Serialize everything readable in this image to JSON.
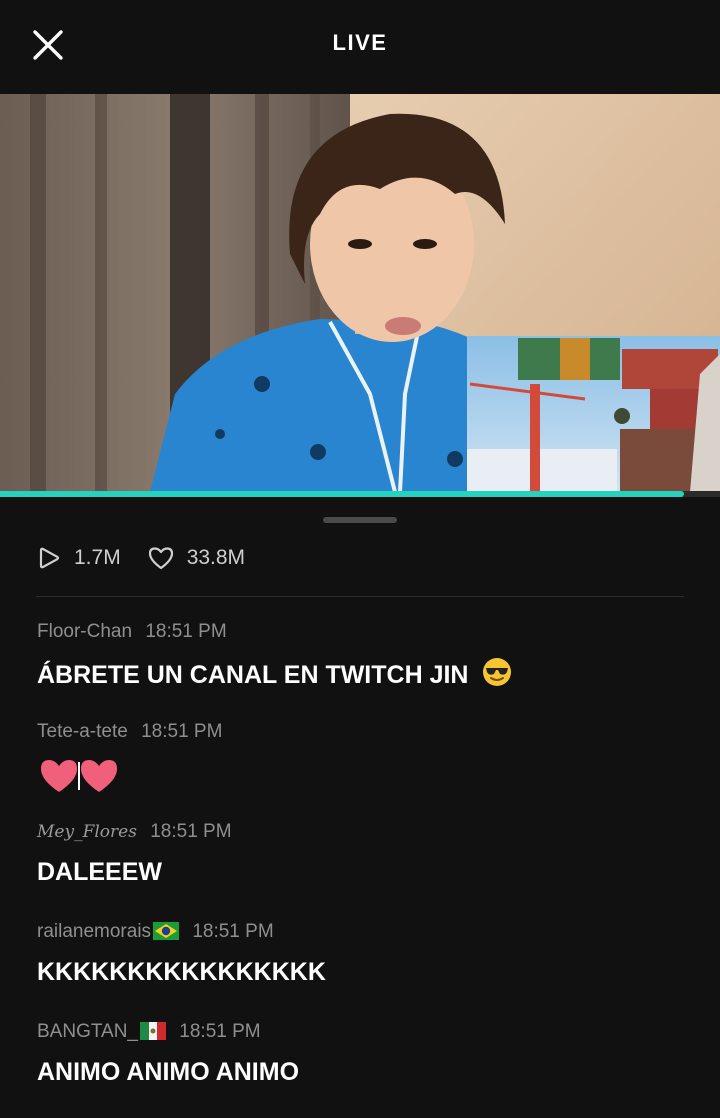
{
  "header": {
    "title": "LIVE",
    "close_icon": "close-icon"
  },
  "video": {
    "progress_fraction": 0.95,
    "accent_color": "#23d3be"
  },
  "stats": {
    "plays": "1.7M",
    "likes": "33.8M",
    "plays_icon": "play-outline-icon",
    "likes_icon": "heart-outline-icon"
  },
  "comments": [
    {
      "user": "Floor-Chan",
      "time": "18:51 PM",
      "text": "ÁBRETE UN CANAL EN TWITCH JIN",
      "emoji": "sunglasses-emoji"
    },
    {
      "user": "Tete-a-tete",
      "time": "18:51 PM",
      "text": "",
      "emoji": "pink-hearts"
    },
    {
      "user": "Mey_Flores",
      "time": "18:51 PM",
      "text": "DALEEEW"
    },
    {
      "user": "railanemorais",
      "flag": "brazil-flag",
      "time": "18:51 PM",
      "text": "KKKKKKKKKKKKKKKK"
    },
    {
      "user": "BANGTAN_",
      "flag": "mexico-flag",
      "time": "18:51 PM",
      "text": "ANIMO ANIMO ANIMO"
    }
  ]
}
